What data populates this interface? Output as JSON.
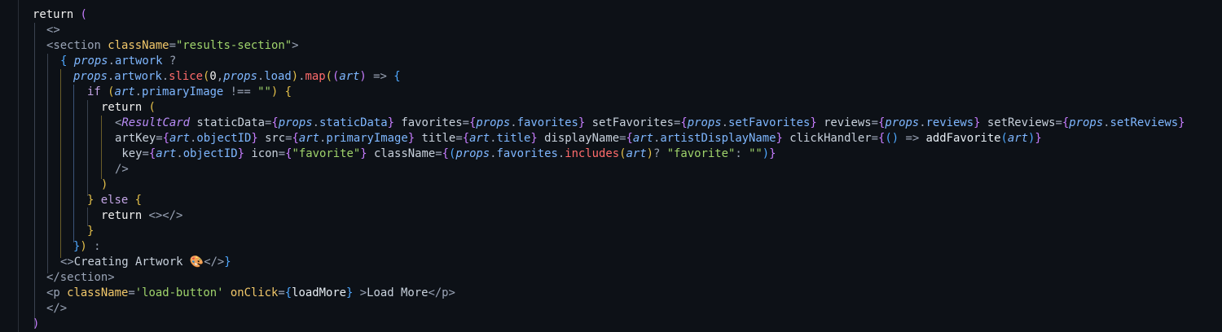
{
  "editor": {
    "lines": [
      "return (",
      "<>",
      "<section className=\"results-section\">",
      "{ props.artwork ?",
      "props.artwork.slice(0,props.load).map((art) => {",
      "if (art.primaryImage !== \"\") {",
      "return (",
      "<ResultCard staticData={props.staticData} favorites={props.favorites} setFavorites={props.setFavorites} reviews={props.reviews} setReviews={props.setReviews}",
      "artKey={art.objectID} src={art.primaryImage} title={art.title} displayName={art.artistDisplayName} clickHandler={() => addFavorite(art)}",
      " key={art.objectID} icon={\"favorite\"} className={(props.favorites.includes(art)? \"favorite\": \"\")}",
      "/>",
      ")",
      "} else {",
      "return <></>",
      "}",
      "}) :",
      "<>Creating Artwork 🎨</>}",
      "</section>",
      "<p className='load-button' onClick={loadMore} >Load More</p>",
      "</>",
      ")"
    ]
  }
}
